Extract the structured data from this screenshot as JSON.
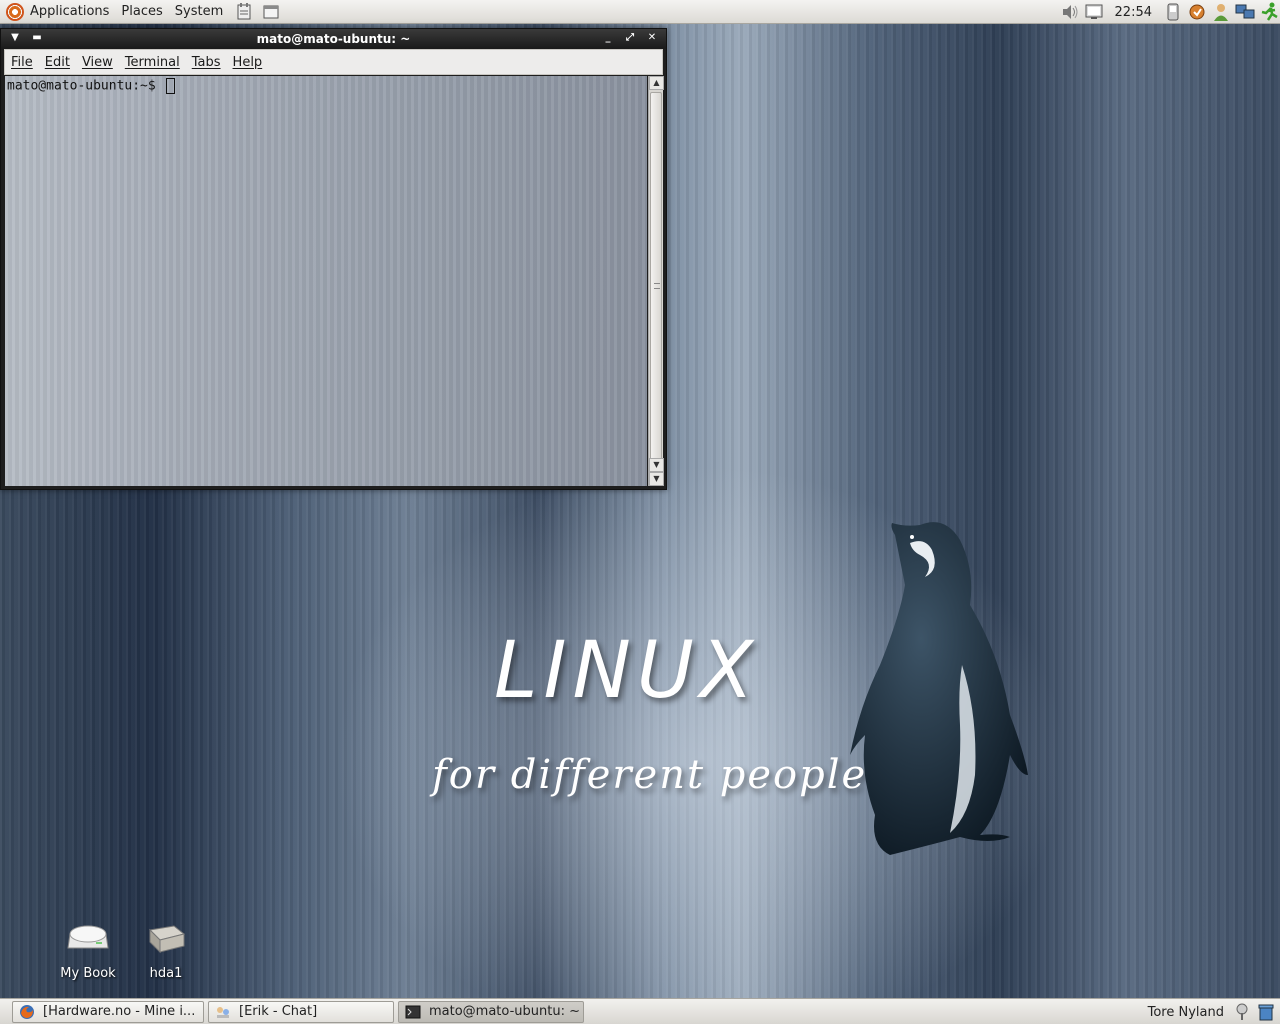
{
  "top_panel": {
    "menus": [
      "Applications",
      "Places",
      "System"
    ],
    "clock": "22:54"
  },
  "terminal": {
    "title": "mato@mato-ubuntu: ~",
    "menu": [
      "File",
      "Edit",
      "View",
      "Terminal",
      "Tabs",
      "Help"
    ],
    "prompt": "mato@mato-ubuntu:~$"
  },
  "wallpaper": {
    "title": "LINUX",
    "subtitle": "for different people"
  },
  "desktop_icons": [
    {
      "label": "My Book"
    },
    {
      "label": "hda1"
    }
  ],
  "taskbar": {
    "tasks": [
      {
        "label": "[Hardware.no - Mine i..."
      },
      {
        "label": "[Erik - Chat]"
      },
      {
        "label": "mato@mato-ubuntu: ~"
      }
    ],
    "user": "Tore Nyland"
  }
}
